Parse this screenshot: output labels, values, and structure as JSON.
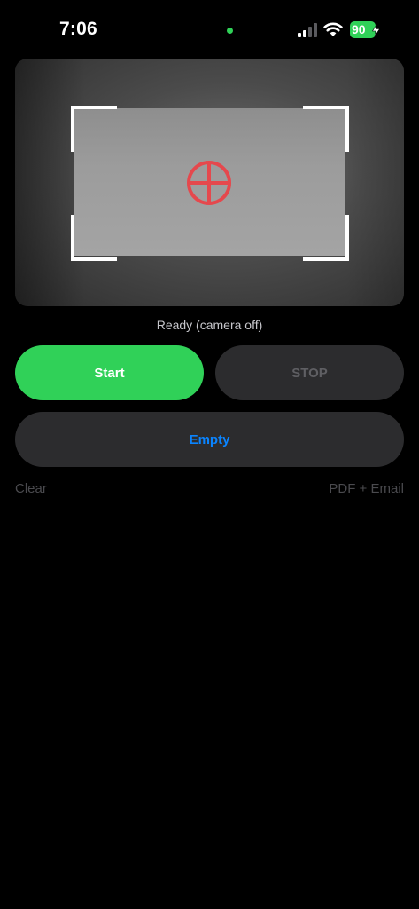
{
  "status_bar": {
    "time": "7:06",
    "battery_level": "90",
    "signal_bars_active": 2,
    "signal_bars_total": 4,
    "privacy_dot_color": "#30d158",
    "battery_color": "#30d158",
    "icons": [
      "signal-icon",
      "wifi-icon",
      "battery-icon",
      "charging-bolt-icon"
    ]
  },
  "camera": {
    "crosshair_color": "#e5484d",
    "frame_color": "#ffffff"
  },
  "status_text": "Ready (camera off)",
  "buttons": {
    "start_label": "Start",
    "stop_label": "STOP",
    "empty_label": "Empty"
  },
  "links": {
    "clear_label": "Clear",
    "pdf_email_label": "PDF + Email"
  },
  "colors": {
    "accent_green": "#30d158",
    "accent_blue": "#0a84ff",
    "button_dark": "#2c2c2e",
    "background": "#000000"
  }
}
